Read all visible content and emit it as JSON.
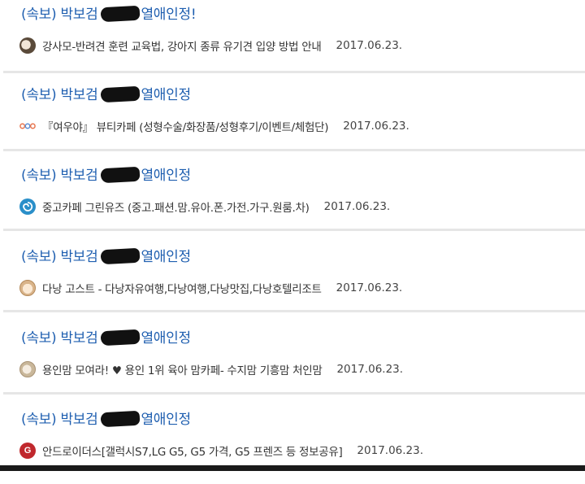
{
  "posts": [
    {
      "title_prefix": "(속보) 박보검",
      "title_suffix": "열애인정!",
      "cafe": "강사모-반려견 훈련 교육법, 강아지 종류 유기견 입양 방법 안내",
      "date": "2017.06.23.",
      "icon": "dog-avatar-icon",
      "icon_color": "#5a4a3a"
    },
    {
      "title_prefix": "(속보) 박보검",
      "title_suffix": "열애인정",
      "cafe": "『여우야』 뷰티카페 (성형수술/화장품/성형후기/이벤트/체험단)",
      "date": "2017.06.23.",
      "icon": "fox-logo-icon",
      "icon_color": "#e8724a"
    },
    {
      "title_prefix": "(속보) 박보검",
      "title_suffix": "열애인정",
      "cafe": "중고카페 그린유즈 (중고.패션.맘.유아.폰.가전.가구.원룸.차)",
      "date": "2017.06.23.",
      "icon": "green-use-logo-icon",
      "icon_color": "#2a8fc9"
    },
    {
      "title_prefix": "(속보) 박보검",
      "title_suffix": "열애인정",
      "cafe": "다낭 고스트 - 다낭자유여행,다낭여행,다낭맛집,다낭호텔리조트",
      "date": "2017.06.23.",
      "icon": "ghost-avatar-icon",
      "icon_color": "#d9b48a"
    },
    {
      "title_prefix": "(속보) 박보검",
      "title_suffix": "열애인정",
      "cafe": "용인맘 모여라! ♥ 용인 1위 육아 맘카페- 수지맘 기흥맘 처인맘",
      "date": "2017.06.23.",
      "icon": "mom-avatar-icon",
      "icon_color": "#c9b79a"
    },
    {
      "title_prefix": "(속보) 박보검",
      "title_suffix": "열애인정",
      "cafe": "안드로이더스[갤럭시S7,LG G5, G5 가격, G5 프렌즈 등 정보공유]",
      "date": "2017.06.23.",
      "icon": "g-logo-icon",
      "icon_color": "#c0282d"
    }
  ]
}
